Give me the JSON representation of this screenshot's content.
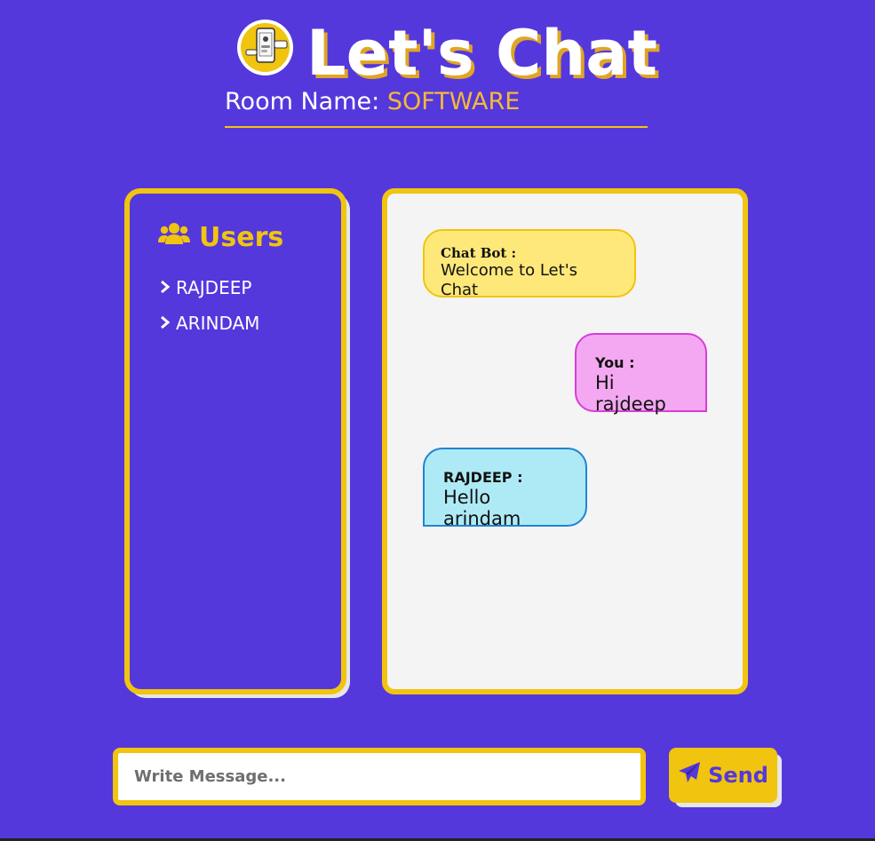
{
  "header": {
    "title": "Let's Chat",
    "logo_icon": "chat-phone-logo-icon",
    "room_label": "Room Name:",
    "room_name": "SOFTWARE"
  },
  "users_panel": {
    "heading": "Users",
    "heading_icon": "users-icon",
    "users": [
      "RAJDEEP",
      "ARINDAM"
    ]
  },
  "messages": [
    {
      "sender": "Chat Bot :",
      "text": "Welcome to Let's Chat"
    },
    {
      "sender": "You :",
      "text": "Hi rajdeep"
    },
    {
      "sender": "RAJDEEP :",
      "text": "Hello arindam"
    }
  ],
  "composer": {
    "placeholder": "Write Message...",
    "send_label": "Send",
    "send_icon": "paper-plane-icon"
  },
  "colors": {
    "background": "#5438dc",
    "accent": "#f1c40f",
    "bot_bubble": "#ffe87a",
    "own_bubble": "#f3a8f1",
    "other_bubble": "#aeeaf6"
  }
}
